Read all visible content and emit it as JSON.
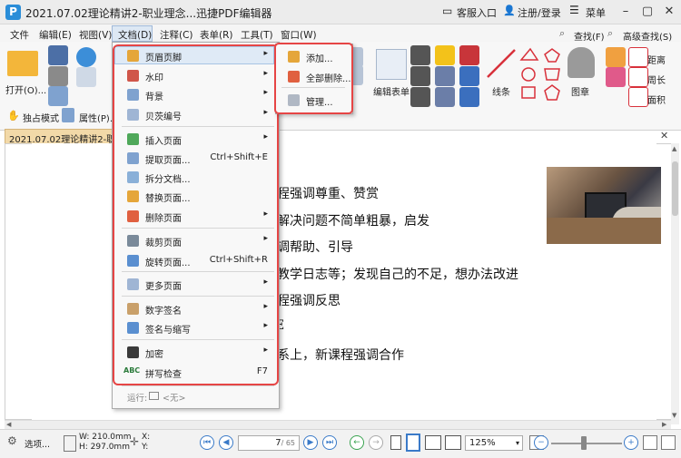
{
  "app": {
    "title": "2021.07.02理论精讲2-职业理念...迅捷PDF编辑器",
    "logo_letter": "P",
    "support": "客服入口",
    "login": "注册/登录",
    "menu": "菜单"
  },
  "menubar": [
    "文件",
    "编辑(E)",
    "视图(V)",
    "文档(D)",
    "注释(C)",
    "表单(R)",
    "工具(T)",
    "窗口(W)"
  ],
  "ribbon": {
    "open": "打开(O)...",
    "edit_form": "编辑表单",
    "line": "线条",
    "stamp": "图章",
    "distance": "距离",
    "perimeter": "周长",
    "area": "面积",
    "find": "查找(F)",
    "adv_find": "高级查找(S)",
    "exclusive_mode": "独占模式",
    "properties": "属性(P)..."
  },
  "doc_tab": "2021.07.02理论精讲2-职业理",
  "document_lines": [
    "课程强调尊重、赞赏",
    "，解决问题不简单粗暴，启发",
    "强调帮助、引导",
    "、教学日志等；发现自己的不足，想办法改进",
    "课程强调反思",
    "E",
    "关系上，新课程强调合作"
  ],
  "dropdown": {
    "items": [
      {
        "label": "页眉页脚",
        "shortcut": "",
        "arrow": "▸"
      },
      {
        "label": "水印",
        "shortcut": "",
        "arrow": "▸"
      },
      {
        "label": "背景",
        "shortcut": "",
        "arrow": "▸"
      },
      {
        "label": "贝茨编号",
        "shortcut": "",
        "arrow": "▸"
      },
      {
        "label": "插入页面",
        "shortcut": "",
        "arrow": "▸"
      },
      {
        "label": "提取页面...",
        "shortcut": "Ctrl+Shift+E",
        "arrow": ""
      },
      {
        "label": "拆分文档...",
        "shortcut": "",
        "arrow": ""
      },
      {
        "label": "替换页面...",
        "shortcut": "",
        "arrow": ""
      },
      {
        "label": "删除页面",
        "shortcut": "",
        "arrow": "▸"
      },
      {
        "label": "裁剪页面",
        "shortcut": "",
        "arrow": "▸"
      },
      {
        "label": "旋转页面...",
        "shortcut": "Ctrl+Shift+R",
        "arrow": ""
      },
      {
        "label": "更多页面",
        "shortcut": "",
        "arrow": "▸"
      },
      {
        "label": "数字签名",
        "shortcut": "",
        "arrow": "▸"
      },
      {
        "label": "签名与缩写",
        "shortcut": "",
        "arrow": "▸"
      },
      {
        "label": "加密",
        "shortcut": "",
        "arrow": "▸"
      },
      {
        "label": "拼写检查",
        "shortcut": "F7",
        "arrow": ""
      }
    ],
    "run_label": "运行:",
    "run_value": "<无>"
  },
  "submenu": [
    "添加...",
    "全部删除...",
    "管理..."
  ],
  "status": {
    "options": "选项...",
    "width": "W: 210.0mm",
    "height": "H: 297.0mm",
    "x": "X:",
    "y": "Y:",
    "page_current": "7",
    "page_total": "/ 65",
    "zoom": "125%"
  },
  "colors": {
    "highlight_border": "#e64545",
    "menu_active": "#dfeaf6",
    "accent": "#2a8dd8"
  }
}
